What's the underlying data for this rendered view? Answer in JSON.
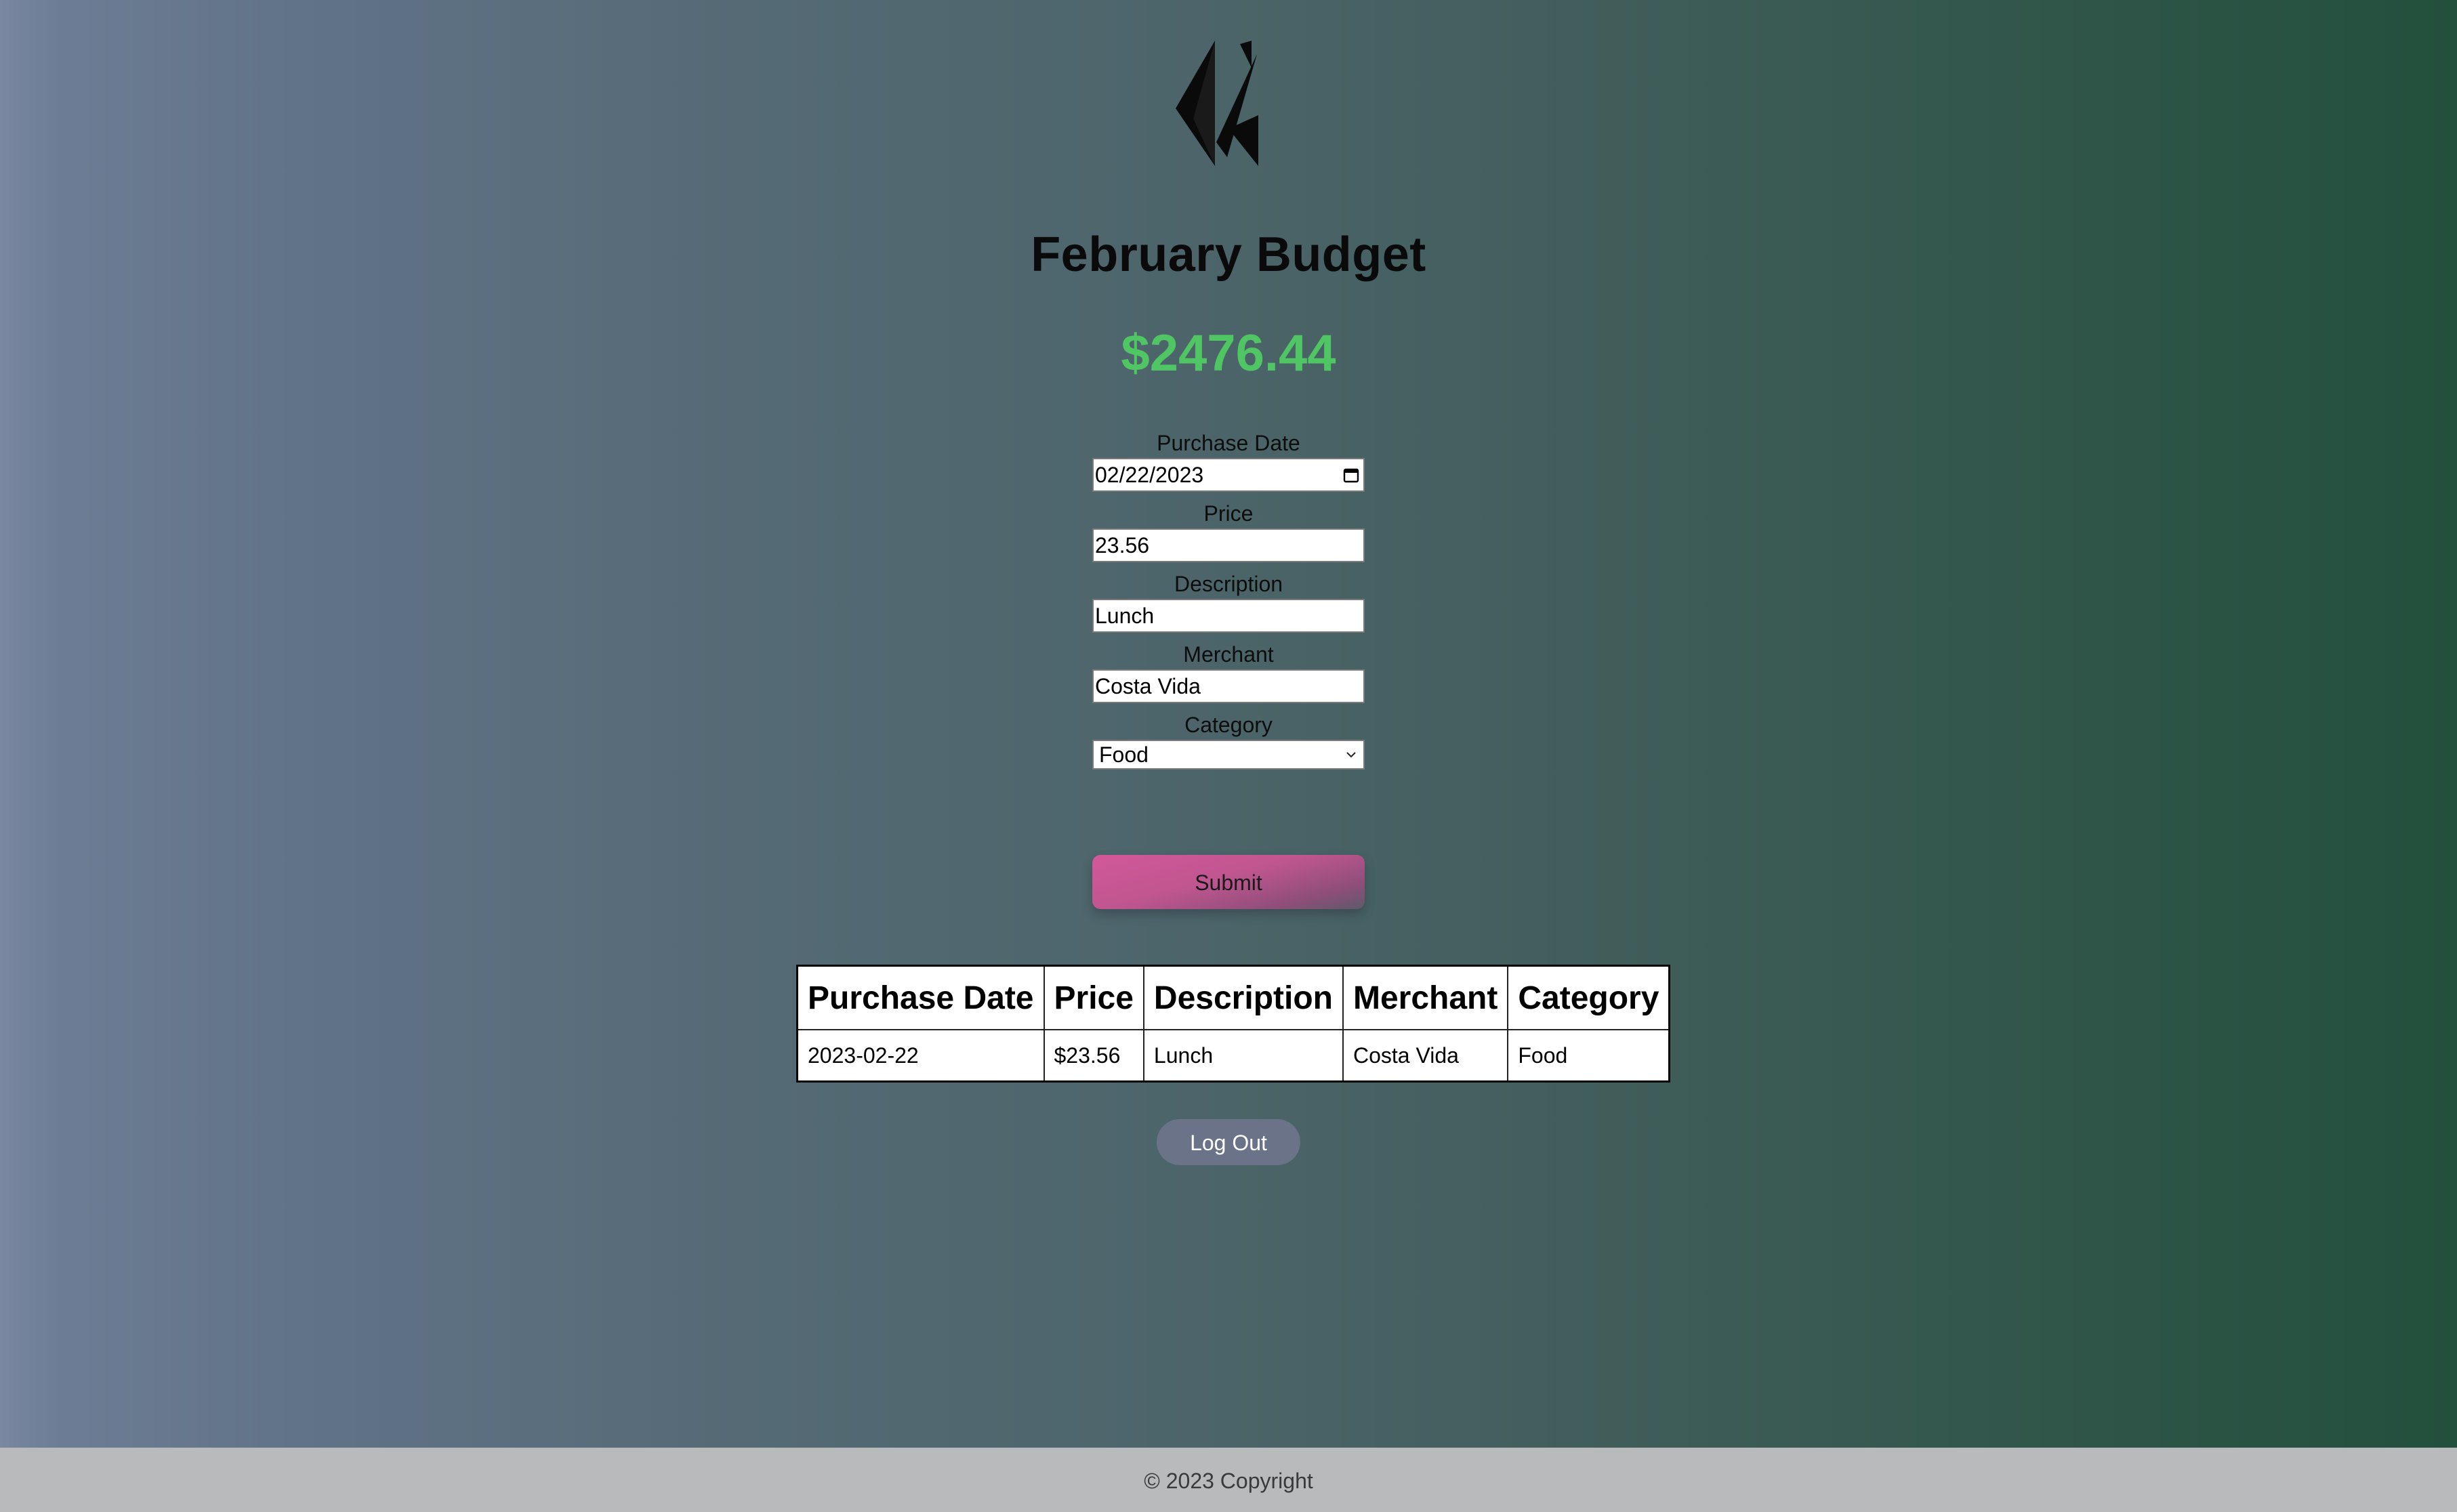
{
  "header": {
    "logo_icon": "angular-k-logo-icon",
    "title": "February Budget",
    "balance": "$2476.44",
    "balance_color": "#4fc563"
  },
  "form": {
    "purchase_date_label": "Purchase Date",
    "purchase_date_value": "02/22/2023",
    "price_label": "Price",
    "price_value": "23.56",
    "description_label": "Description",
    "description_value": "Lunch",
    "merchant_label": "Merchant",
    "merchant_value": "Costa Vida",
    "category_label": "Category",
    "category_value": "Food",
    "submit_label": "Submit"
  },
  "table": {
    "headers": [
      "Purchase Date",
      "Price",
      "Description",
      "Merchant",
      "Category"
    ],
    "rows": [
      [
        "2023-02-22",
        "$23.56",
        "Lunch",
        "Costa Vida",
        "Food"
      ]
    ]
  },
  "logout_label": "Log Out",
  "footer": {
    "copyright": "© 2023 Copyright"
  }
}
